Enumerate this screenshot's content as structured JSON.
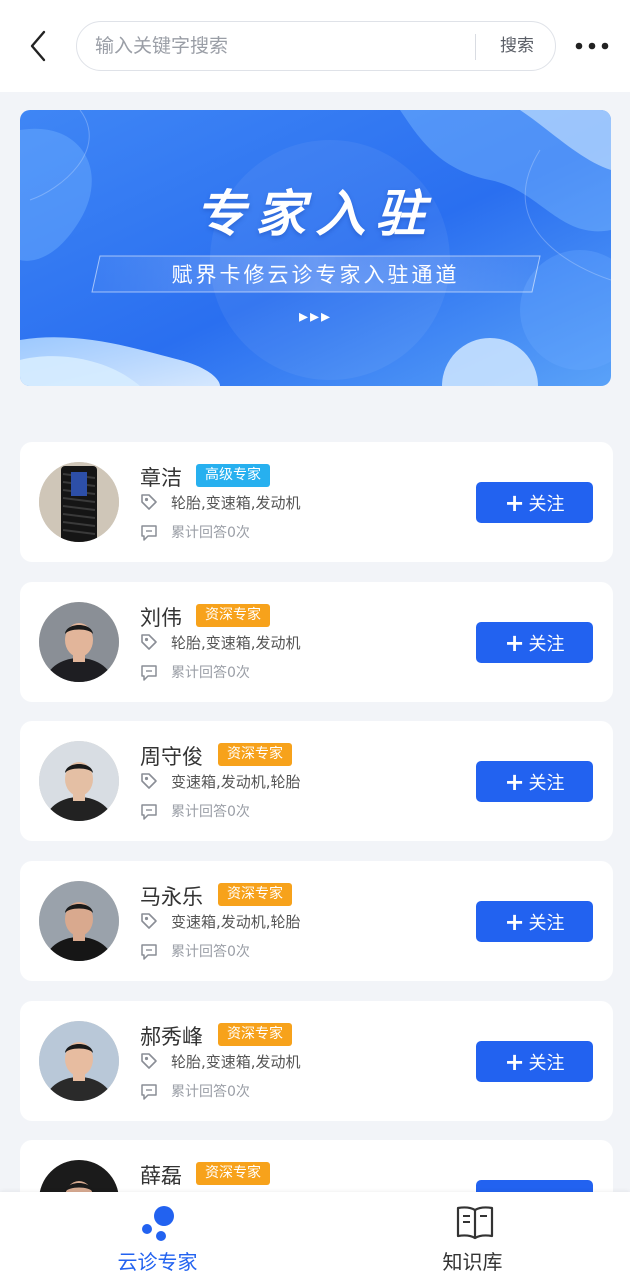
{
  "header": {
    "search_placeholder": "输入关键字搜索",
    "search_button": "搜索",
    "back_icon": "chevron-left-icon",
    "more_icon": "more-dots-icon"
  },
  "banner": {
    "title": "专家入驻",
    "subtitle": "赋界卡修云诊专家入驻通道",
    "arrows": "▸▸▸"
  },
  "follow_label": "关注",
  "experts": [
    {
      "name": "章洁",
      "badge": "高级专家",
      "badge_color": "#27b0ef",
      "tags": "轮胎,变速箱,发动机",
      "replies": "累计回答0次"
    },
    {
      "name": "刘伟",
      "badge": "资深专家",
      "badge_color": "#f7a21b",
      "tags": "轮胎,变速箱,发动机",
      "replies": "累计回答0次"
    },
    {
      "name": "周守俊",
      "badge": "资深专家",
      "badge_color": "#f7a21b",
      "tags": "变速箱,发动机,轮胎",
      "replies": "累计回答0次"
    },
    {
      "name": "马永乐",
      "badge": "资深专家",
      "badge_color": "#f7a21b",
      "tags": "变速箱,发动机,轮胎",
      "replies": "累计回答0次"
    },
    {
      "name": "郝秀峰",
      "badge": "资深专家",
      "badge_color": "#f7a21b",
      "tags": "轮胎,变速箱,发动机",
      "replies": "累计回答0次"
    },
    {
      "name": "薛磊",
      "badge": "资深专家",
      "badge_color": "#f7a21b",
      "tags": "",
      "replies": ""
    }
  ],
  "tabbar": {
    "tabs": [
      {
        "label": "云诊专家",
        "icon": "expert-dots-icon",
        "active": true,
        "color": "#2262f0"
      },
      {
        "label": "知识库",
        "icon": "book-icon",
        "active": false,
        "color": "#333333"
      }
    ]
  }
}
